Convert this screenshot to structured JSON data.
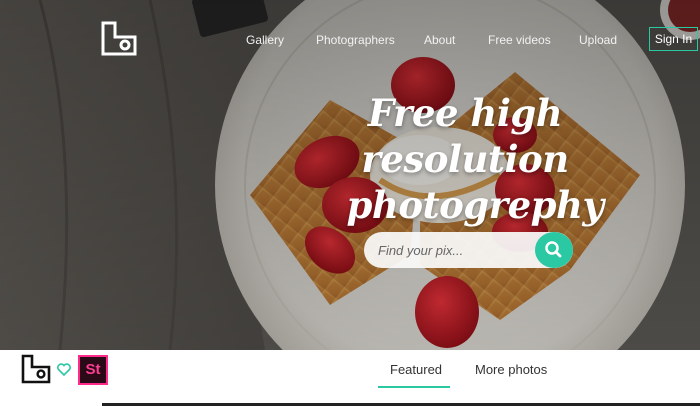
{
  "nav": {
    "logo_icon": "camera-frame-logo",
    "items": [
      "Gallery",
      "Photographers",
      "About",
      "Free videos",
      "Upload"
    ],
    "signin": "Sign In"
  },
  "hero": {
    "headline_line1": "Free high resolution",
    "headline_line2": "photogrephy",
    "search_placeholder": "Find your pix...",
    "search_icon": "search-icon"
  },
  "bar": {
    "logo_icon": "camera-frame-logo",
    "heart_icon": "heart-icon",
    "badge": "St",
    "tabs": [
      "Featured",
      "More photos"
    ],
    "active_tab": "Featured"
  },
  "colors": {
    "accent": "#2bc8a4",
    "badge_border": "#ff2a8a",
    "badge_bg": "#2a0a17"
  }
}
